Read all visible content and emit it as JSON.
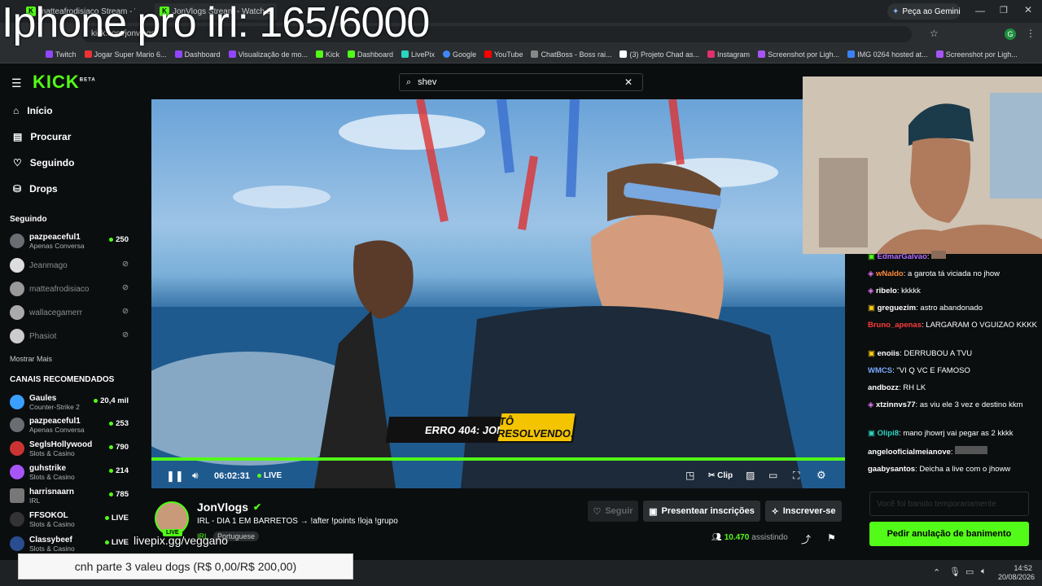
{
  "overlay_title": "Iphone pro irl: 165/6000",
  "browser": {
    "tabs": [
      "matteafrodisiaco Stream - Watc",
      "JonVlogs Stream - Watch Li",
      "...com"
    ],
    "url": "kick.com/jonvlogs",
    "gemini_button": "Peça ao Gemini",
    "bookmarks": [
      "Twitch",
      "Jogar Super Mario 6...",
      "Dashboard",
      "Visualização de mo...",
      "Kick",
      "Dashboard",
      "LivePix",
      "Google",
      "YouTube",
      "ChatBoss - Boss rai...",
      "(3) Projeto Chad as...",
      "Instagram",
      "Screenshot por Ligh...",
      "IMG 0264 hosted at...",
      "Screenshot por Ligh..."
    ]
  },
  "kick": {
    "logo": "KICK",
    "logo_badge": "BETA",
    "nav": [
      "Início",
      "Procurar",
      "Seguindo",
      "Drops"
    ],
    "following_title": "Seguindo",
    "following": [
      {
        "name": "pazpeaceful1",
        "category": "Apenas Conversa",
        "count": "250",
        "online": true
      },
      {
        "name": "Jeanmago",
        "online": false
      },
      {
        "name": "matteafrodisiaco",
        "online": false
      },
      {
        "name": "wallacegamerr",
        "online": false
      },
      {
        "name": "Phasiot",
        "online": false
      }
    ],
    "show_more": "Mostrar Mais",
    "recommended_title": "CANAIS RECOMENDADOS",
    "recommended": [
      {
        "name": "Gaules",
        "category": "Counter-Strike 2",
        "count": "20,4 mil"
      },
      {
        "name": "pazpeaceful1",
        "category": "Apenas Conversa",
        "count": "253"
      },
      {
        "name": "SeglsHollywood",
        "category": "Slots & Casino",
        "count": "790"
      },
      {
        "name": "guhstrike",
        "category": "Slots & Casino",
        "count": "214"
      },
      {
        "name": "harrisnaarn",
        "category": "IRL",
        "count": "785"
      },
      {
        "name": "FFSOKOL",
        "category": "Slots & Casino",
        "count": "LIVE"
      },
      {
        "name": "Classybeef",
        "category": "Slots & Casino",
        "count": "LIVE"
      }
    ],
    "search_value": "shev"
  },
  "video": {
    "time": "06:02:31",
    "live_label": "LIVE",
    "clip_label": "Clip",
    "banner_left": "ERRO 404: JON",
    "banner_right": "TÔ RESOLVENDO."
  },
  "stream": {
    "channel": "JonVlogs",
    "title": "IRL - DIA 1 EM BARRETOS → !after !points !loja !grupo",
    "category": "IRL",
    "language": "Portuguese",
    "viewers": "10.470",
    "viewers_label": "assistindo",
    "follow": "Seguir",
    "gift": "Presentear inscrições",
    "subscribe": "Inscrever-se",
    "live_badge": "LIVE"
  },
  "chat": {
    "messages": [
      {
        "user": "EdmarGalvao",
        "text": "",
        "color": "#b56cff"
      },
      {
        "user": "wNaldo",
        "text": "a garota tá viciada no jhow",
        "color": "#ff8a3c"
      },
      {
        "user": "ribelo",
        "text": "kkkkk",
        "color": "#ffffff"
      },
      {
        "user": "greguezim",
        "text": "astro abandonado",
        "color": "#ffffff"
      },
      {
        "user": "Bruno_apenas",
        "text": "LARGARAM O VGUIZAO KKKK",
        "color": "#ff3b3b"
      },
      {
        "user": "enoiis",
        "text": "DERRUBOU A TVU",
        "color": "#ffffff"
      },
      {
        "user": "WMCS",
        "text": "\"VI Q VC E FAMOSO",
        "color": "#7aa9ff"
      },
      {
        "user": "andbozz",
        "text": "RH LK",
        "color": "#ffffff"
      },
      {
        "user": "xtzinnvs77",
        "text": "as viu ele 3 vez e destino kkm",
        "color": "#ffffff"
      },
      {
        "user": "Olipi8",
        "text": "mano jhowrj vai pegar as 2 kkkk",
        "color": "#ffffff"
      },
      {
        "user": "angelooficialmeianove",
        "text": "",
        "color": "#ffffff"
      },
      {
        "user": "gaabysantos",
        "text": "Deicha a live com o jhoww",
        "color": "#ffffff"
      }
    ],
    "unban_button": "Pedir anulação de banimento",
    "input_placeholder": "Você foi banido temporariamente"
  },
  "livepix": "livepix.gg/veggano",
  "donation": "cnh parte 3 valeu dogs (R$ 0,00/R$ 200,00)",
  "taskbar": {
    "time": "14:52",
    "date": "20/08/2026"
  },
  "colors": {
    "kick_green": "#53fc18",
    "bg": "#0b0e0f"
  }
}
